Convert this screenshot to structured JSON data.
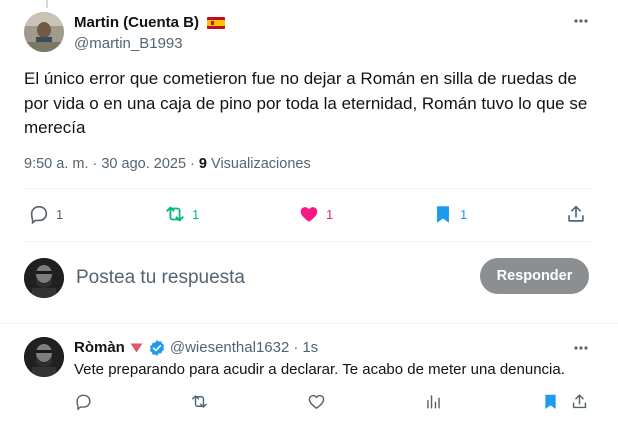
{
  "post": {
    "author_name": "Martin (Cuenta B)",
    "author_handle": "@martin_B1993",
    "flag": "spain-flag-icon",
    "text": "El único error que cometieron fue no dejar a Román en silla de ruedas de por vida o en una caja de pino por toda la eternidad, Román tuvo lo que se merecía",
    "time": "9:50 a. m. · 30 ago. 2025 · ",
    "views_count": "9",
    "views_label": " Visualizaciones",
    "counts": {
      "replies": "1",
      "reposts": "1",
      "likes": "1",
      "bookmarks": "1"
    }
  },
  "composer": {
    "placeholder": "Postea tu respuesta",
    "reply_button": "Responder"
  },
  "reply": {
    "name": "Ròmàn",
    "handle": "@wiesenthal1632",
    "separator": "·",
    "time": "1s",
    "text": "Vete preparando para acudir a declarar. Te acabo de meter una denuncia."
  },
  "colors": {
    "text_primary": "#0f1419",
    "text_secondary": "#536471",
    "repost_green": "#00ba7c",
    "like_pink": "#f91880",
    "bookmark_blue": "#1d9bf0",
    "reply_button_disabled": "#8c8f91",
    "verified_blue": "#1d9bf0"
  }
}
